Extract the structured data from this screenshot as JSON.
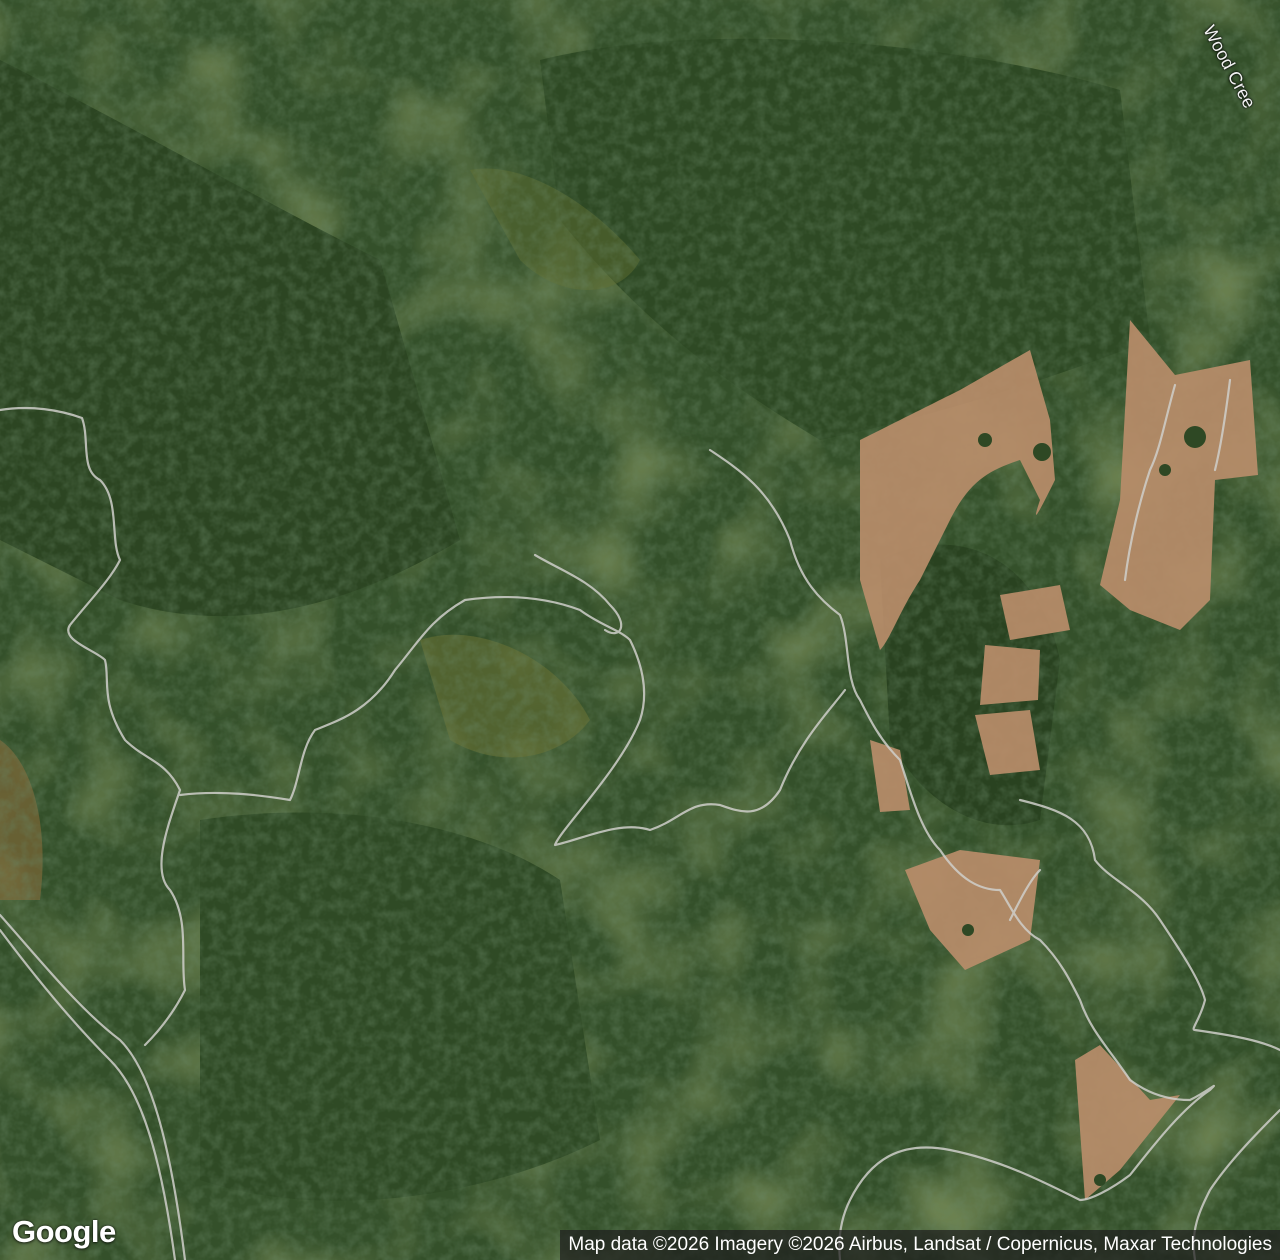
{
  "map": {
    "view": "satellite",
    "labels": {
      "creek_name": "Wood Cree"
    },
    "branding": {
      "logo_text": "Google"
    },
    "attribution": "Map data ©2026 Imagery ©2026 Airbus, Landsat / Copernicus, Maxar Technologies"
  }
}
